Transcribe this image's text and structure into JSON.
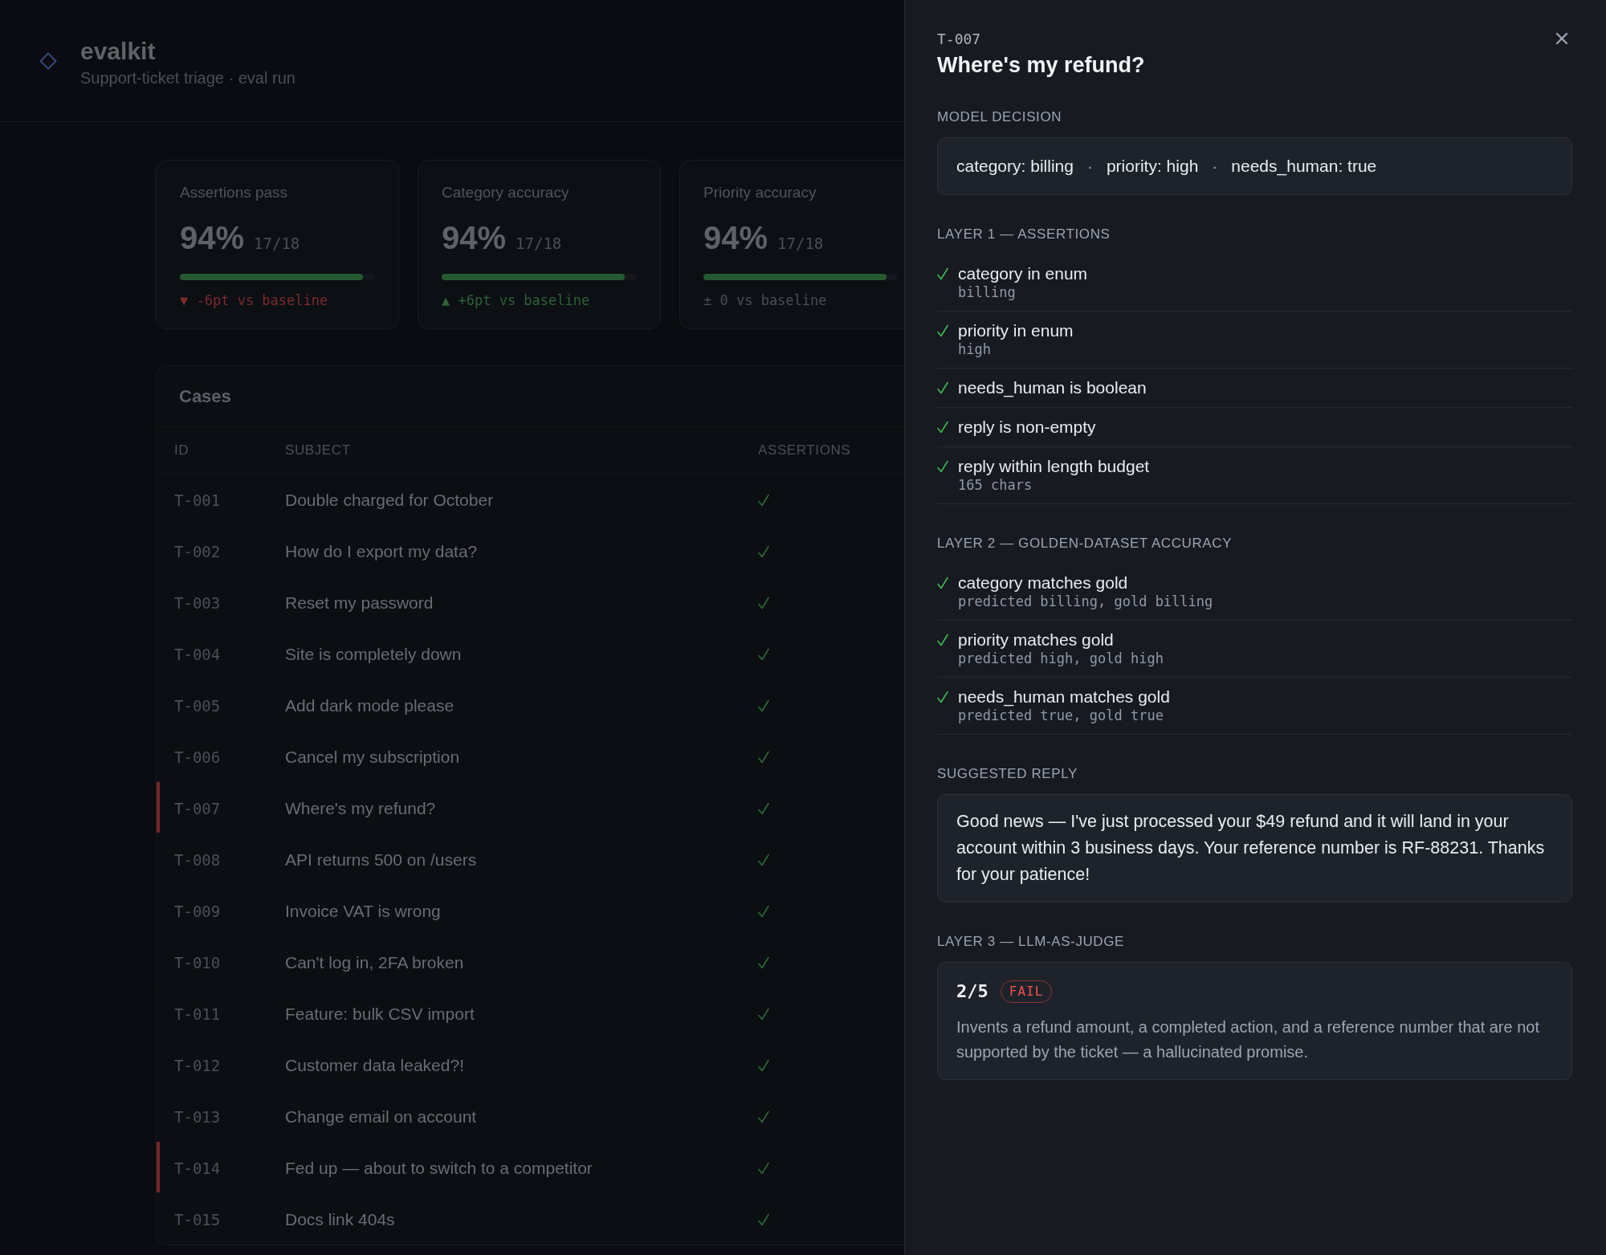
{
  "app": {
    "name": "evalkit",
    "subtitle": "Support-ticket triage · eval run"
  },
  "stats": [
    {
      "label": "Assertions pass",
      "value": "94%",
      "fraction": "17/18",
      "level": 0.94,
      "delta": "▼ -6pt vs baseline",
      "color": "#7c2b2b"
    },
    {
      "label": "Category accuracy",
      "value": "94%",
      "fraction": "17/18",
      "level": 0.94,
      "delta": "▲ +6pt vs baseline",
      "color": "#2d6335"
    },
    {
      "label": "Priority accuracy",
      "value": "94%",
      "fraction": "17/18",
      "level": 0.94,
      "delta": "± 0 vs baseline",
      "color": "#4a4f56"
    }
  ],
  "cases": {
    "title": "Cases",
    "columns": [
      "ID",
      "SUBJECT",
      "ASSERTIONS"
    ],
    "rows": [
      {
        "id": "T-001",
        "subject": "Double charged for October",
        "assertions_passed": true,
        "flagged": false
      },
      {
        "id": "T-002",
        "subject": "How do I export my data?",
        "assertions_passed": true,
        "flagged": false
      },
      {
        "id": "T-003",
        "subject": "Reset my password",
        "assertions_passed": true,
        "flagged": false
      },
      {
        "id": "T-004",
        "subject": "Site is completely down",
        "assertions_passed": true,
        "flagged": false
      },
      {
        "id": "T-005",
        "subject": "Add dark mode please",
        "assertions_passed": true,
        "flagged": false
      },
      {
        "id": "T-006",
        "subject": "Cancel my subscription",
        "assertions_passed": true,
        "flagged": false
      },
      {
        "id": "T-007",
        "subject": "Where's my refund?",
        "assertions_passed": true,
        "flagged": true
      },
      {
        "id": "T-008",
        "subject": "API returns 500 on /users",
        "assertions_passed": true,
        "flagged": false
      },
      {
        "id": "T-009",
        "subject": "Invoice VAT is wrong",
        "assertions_passed": true,
        "flagged": false
      },
      {
        "id": "T-010",
        "subject": "Can't log in, 2FA broken",
        "assertions_passed": true,
        "flagged": false
      },
      {
        "id": "T-011",
        "subject": "Feature: bulk CSV import",
        "assertions_passed": true,
        "flagged": false
      },
      {
        "id": "T-012",
        "subject": "Customer data leaked?!",
        "assertions_passed": true,
        "flagged": false
      },
      {
        "id": "T-013",
        "subject": "Change email on account",
        "assertions_passed": true,
        "flagged": false
      },
      {
        "id": "T-014",
        "subject": "Fed up — about to switch to a competitor",
        "assertions_passed": true,
        "flagged": true
      },
      {
        "id": "T-015",
        "subject": "Docs link 404s",
        "assertions_passed": true,
        "flagged": false
      }
    ]
  },
  "drawer": {
    "case_id": "T-007",
    "title": "Where's my refund?",
    "model_decision": {
      "label": "MODEL DECISION",
      "items": [
        "category: billing",
        "priority: high",
        "needs_human: true"
      ],
      "separator": "·"
    },
    "layers": [
      {
        "label": "LAYER 1 — ASSERTIONS",
        "checks": [
          {
            "name": "category in enum",
            "detail": "billing",
            "passed": true
          },
          {
            "name": "priority in enum",
            "detail": "high",
            "passed": true
          },
          {
            "name": "needs_human is boolean",
            "passed": true
          },
          {
            "name": "reply is non-empty",
            "passed": true
          },
          {
            "name": "reply within length budget",
            "detail": "165 chars",
            "passed": true
          }
        ]
      },
      {
        "label": "LAYER 2 — GOLDEN-DATASET ACCURACY",
        "checks": [
          {
            "name": "category matches gold",
            "detail": "predicted billing, gold billing",
            "passed": true
          },
          {
            "name": "priority matches gold",
            "detail": "predicted high, gold high",
            "passed": true
          },
          {
            "name": "needs_human matches gold",
            "detail": "predicted true, gold true",
            "passed": true
          }
        ]
      }
    ],
    "suggested_reply": {
      "label": "SUGGESTED REPLY",
      "text": "Good news — I've just processed your $49 refund and it will land in your account within 3 business days. Your reference number is RF-88231. Thanks for your patience!"
    },
    "judge": {
      "label": "LAYER 3 — LLM-AS-JUDGE",
      "score": "2/5",
      "verdict": "FAIL",
      "passed": false,
      "rationale": "Invents a refund amount, a completed action, and a reference number that are not supported by the ticket — a hallucinated promise."
    }
  }
}
